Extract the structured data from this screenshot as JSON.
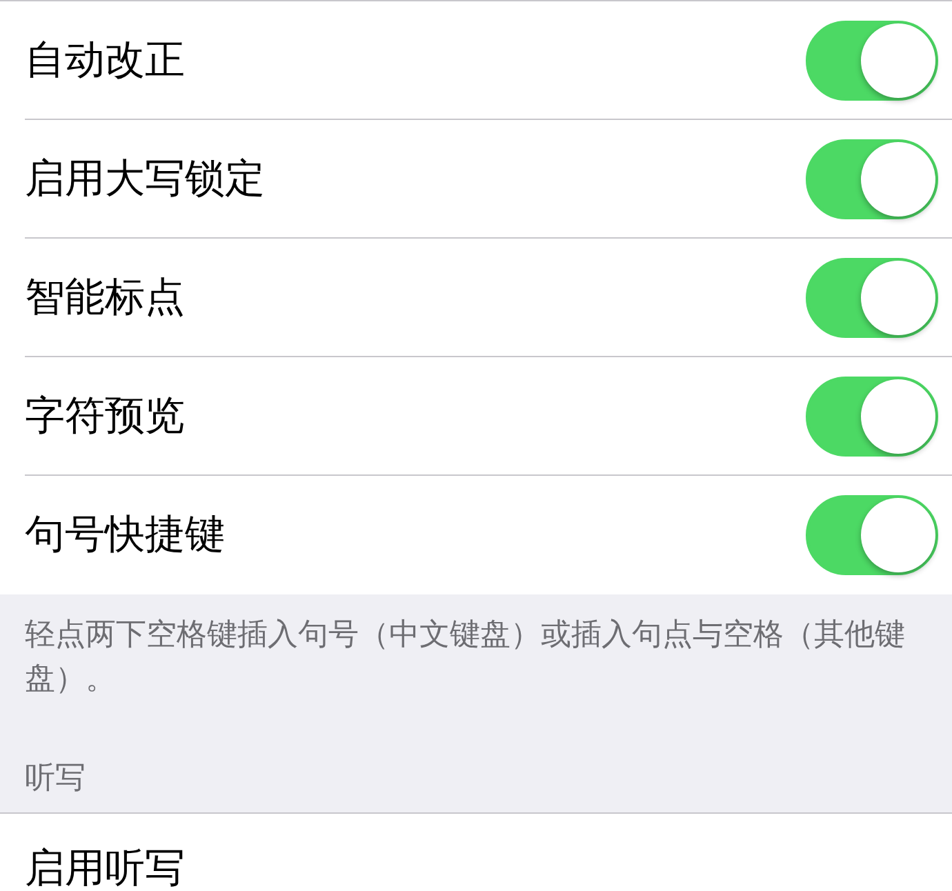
{
  "settings": [
    {
      "label": "自动改正",
      "on": true
    },
    {
      "label": "启用大写锁定",
      "on": true
    },
    {
      "label": "智能标点",
      "on": true
    },
    {
      "label": "字符预览",
      "on": true
    },
    {
      "label": "句号快捷键",
      "on": true
    }
  ],
  "footer_note": "轻点两下空格键插入句号（中文键盘）或插入句点与空格（其他键盘）。",
  "section_header": "听写",
  "dictation_row": {
    "label": "启用听写"
  }
}
